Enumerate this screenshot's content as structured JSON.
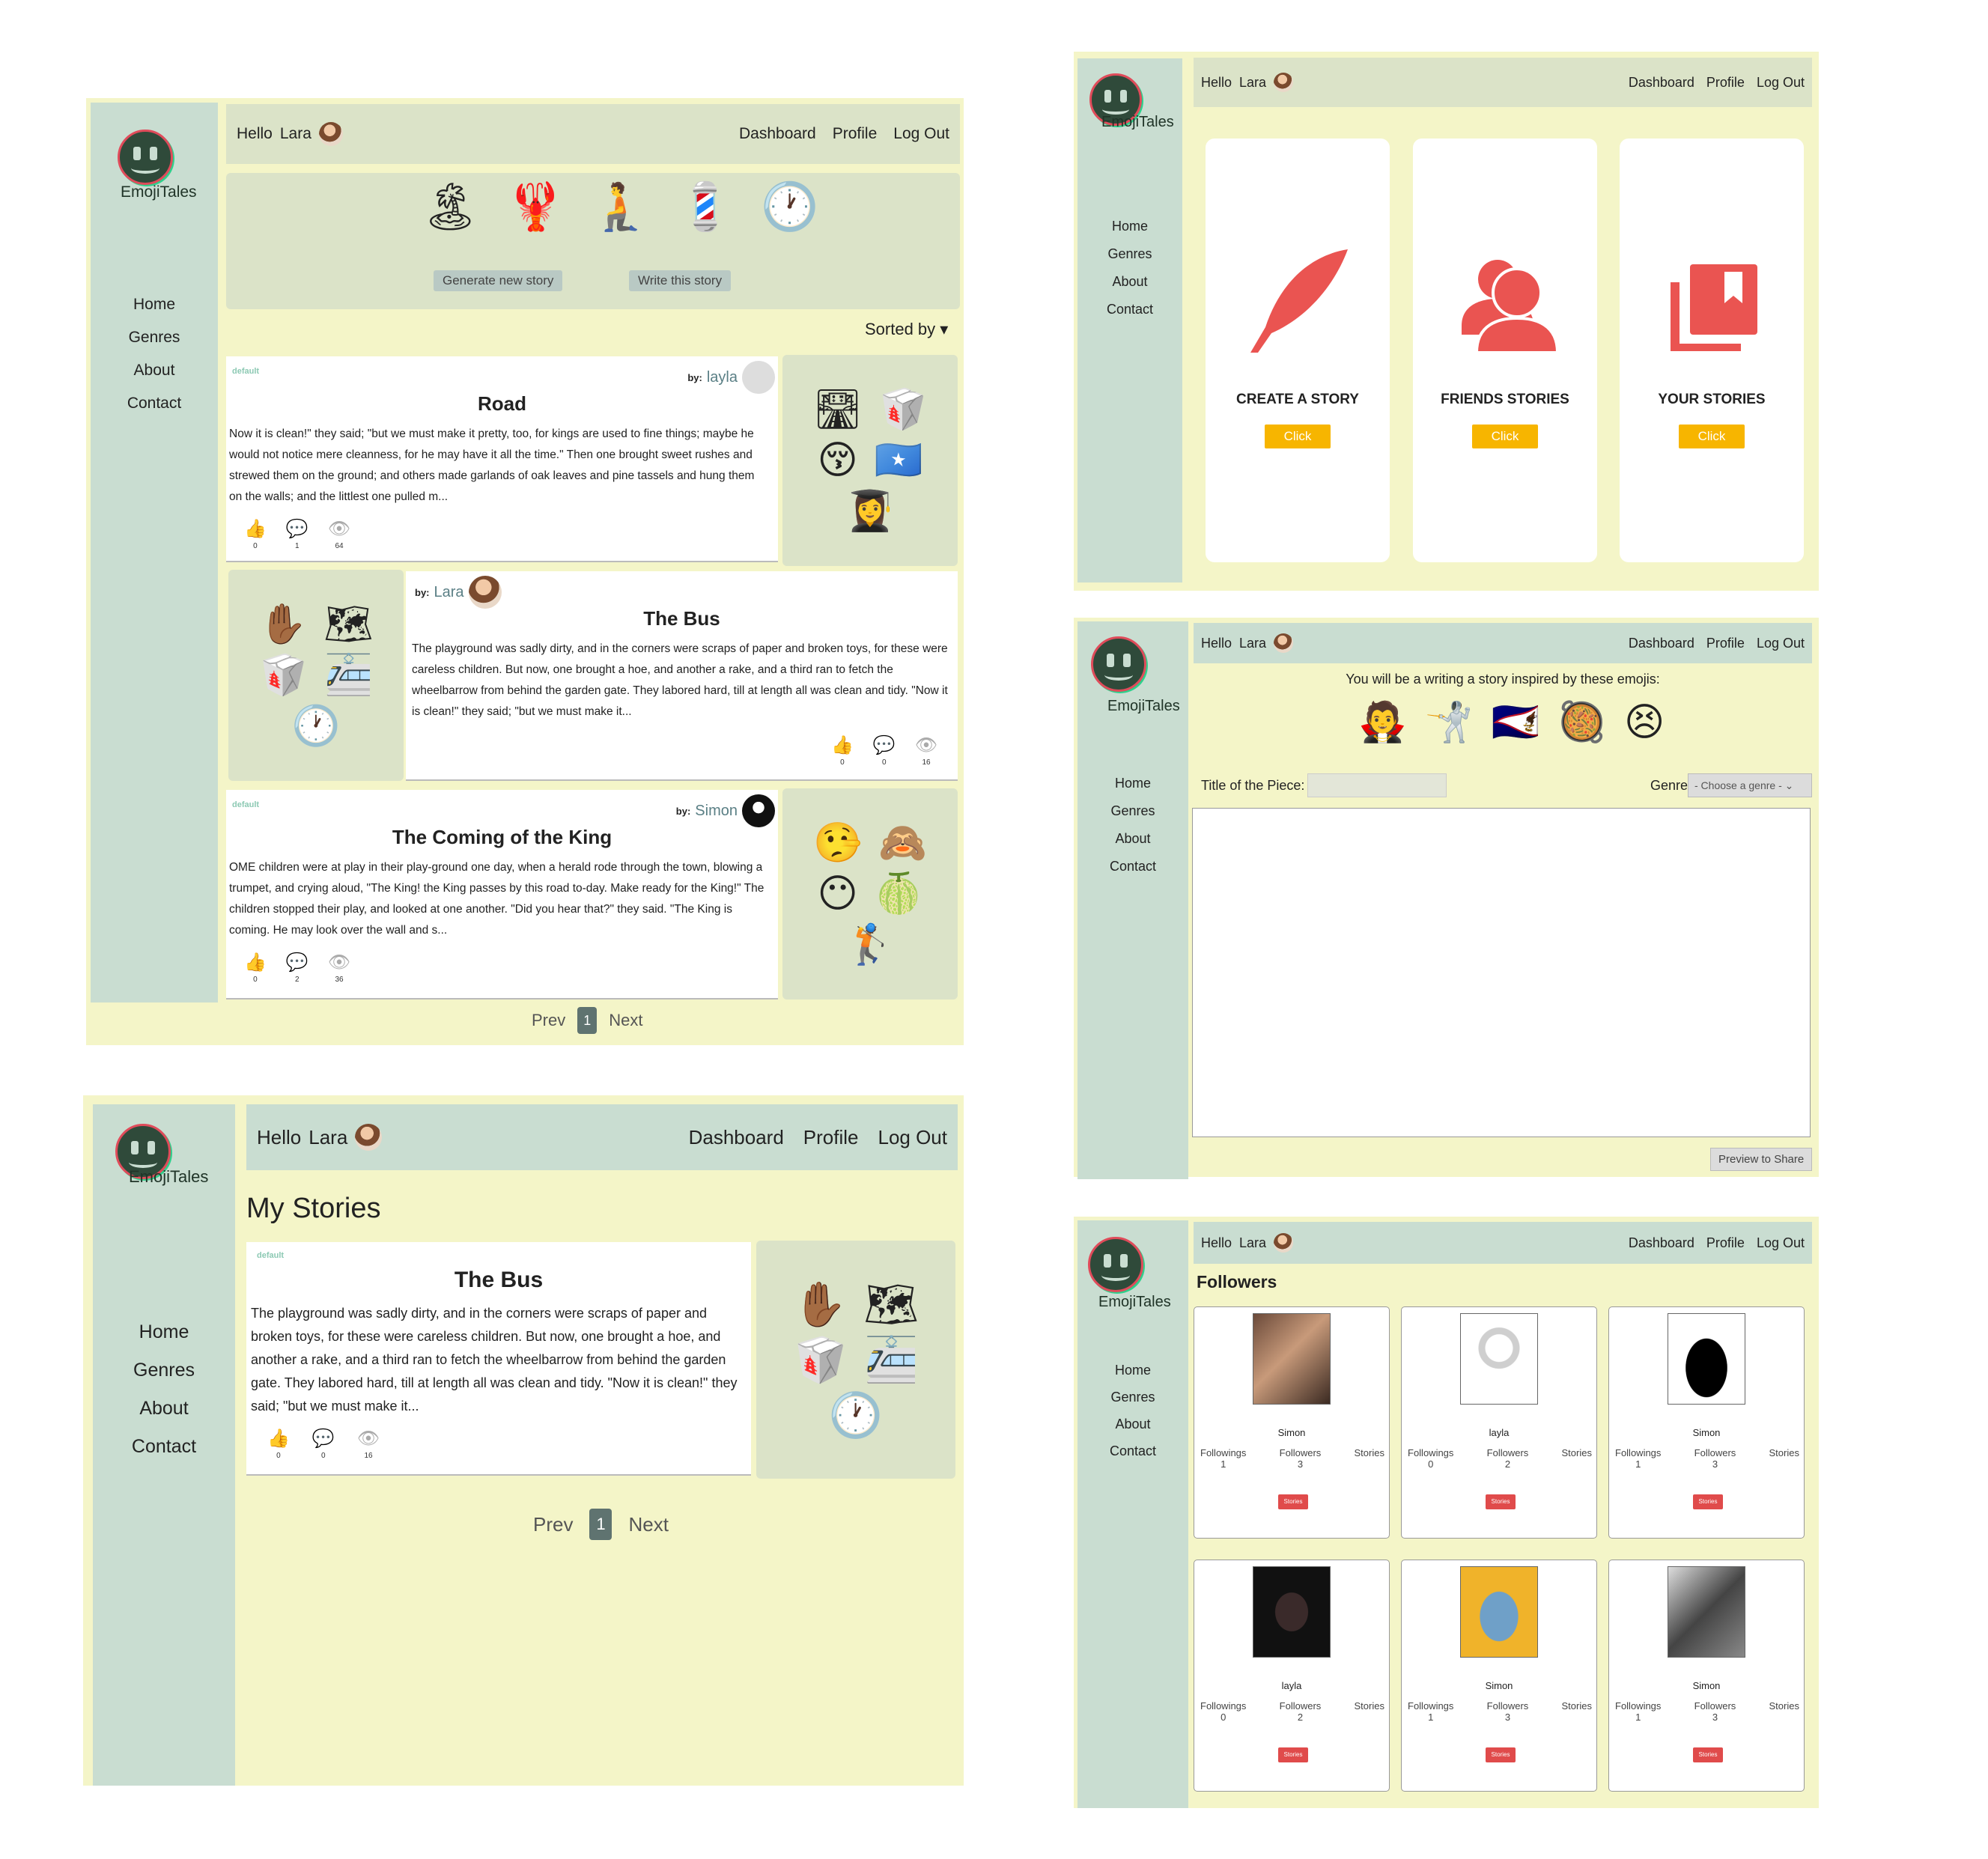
{
  "brand": "EmojiTales",
  "user": "Lara",
  "hello": "Hello",
  "nav": {
    "home": "Home",
    "genres": "Genres",
    "about": "About",
    "contact": "Contact"
  },
  "top": {
    "dashboard": "Dashboard",
    "profile": "Profile",
    "logout": "Log Out"
  },
  "gen": {
    "emojis": [
      "🏝",
      "🦞",
      "🧎",
      "💈",
      "🕐"
    ],
    "generate": "Generate new story",
    "write": "Write this story",
    "sorted": "Sorted by"
  },
  "stories": [
    {
      "tag": "default",
      "by": "by:",
      "author": "layla",
      "title": "Road",
      "text": "Now it is clean!\" they said; \"but we must make it pretty, too, for kings are used to fine things; maybe he would not notice mere cleanness, for he may have it all the time.\" Then one brought sweet rushes and strewed them on the ground; and others made garlands of oak leaves and pine tassels and hung them on the walls; and the littlest one pulled m...",
      "likes": "0",
      "comments": "1",
      "views": "64",
      "emojis": [
        "🛣",
        "🥡",
        "😚",
        "🇸🇴",
        "👩‍🎓"
      ]
    },
    {
      "by": "by:",
      "author": "Lara",
      "title": "The Bus",
      "text": "The playground was sadly dirty, and in the corners were scraps of paper and broken toys, for these were careless children. But now, one brought a hoe, and another a rake, and a third ran to fetch the wheelbarrow from behind the garden gate. They labored hard, till at length all was clean and tidy. \"Now it is clean!\" they said; \"but we must make it...",
      "likes": "0",
      "comments": "0",
      "views": "16",
      "emojis": [
        "✋🏾",
        "🗺",
        "🥡",
        "🚈",
        "🕐"
      ]
    },
    {
      "tag": "default",
      "by": "by:",
      "author": "Simon",
      "title": "The Coming of the King",
      "text": "OME children were at play in their play-ground one day, when a herald rode through the town, blowing a trumpet, and crying aloud, \"The King! the King passes by this road to-day. Make ready for the King!\" The children stopped their play, and looked at one another. \"Did you hear that?\" they said. \"The King is coming. He may look over the wall and s...",
      "likes": "0",
      "comments": "2",
      "views": "36",
      "emojis": [
        "🤥",
        "🙈",
        "😶",
        "🍈",
        "🏌"
      ]
    }
  ],
  "pager": {
    "prev": "Prev",
    "page": "1",
    "next": "Next"
  },
  "dash": {
    "create": "CREATE A STORY",
    "friends": "FRIENDS STORIES",
    "yours": "YOUR STORIES",
    "click": "Click"
  },
  "write": {
    "intro": "You will be a writing a story inspired by these emojis:",
    "emojis": [
      "🧛",
      "🤺",
      "🇦🇸",
      "🥘",
      "😣"
    ],
    "title_label": "Title of the Piece:",
    "genre_label": "Genre:",
    "genre_value": "- Choose a genre -",
    "preview": "Preview to Share"
  },
  "mystories": {
    "heading": "My Stories",
    "tag": "default",
    "title": "The Bus",
    "text": "The playground was sadly dirty, and in the corners were scraps of paper and broken toys, for these were careless children. But now, one brought a hoe, and another a rake, and a third ran to fetch the wheelbarrow from behind the garden gate. They labored hard, till at length all was clean and tidy. \"Now it is clean!\" they said; \"but we must make it...",
    "likes": "0",
    "comments": "0",
    "views": "16",
    "emojis": [
      "✋🏾",
      "🗺",
      "🥡",
      "🚈",
      "🕐"
    ]
  },
  "followers": {
    "heading": "Followers",
    "labels": {
      "followings": "Followings",
      "followers": "Followers",
      "stories": "Stories",
      "btn": "Stories"
    },
    "items": [
      {
        "name": "Simon",
        "followings": "1",
        "followers": "3"
      },
      {
        "name": "layla",
        "followings": "0",
        "followers": "2"
      },
      {
        "name": "Simon",
        "followings": "1",
        "followers": "3"
      },
      {
        "name": "layla",
        "followings": "0",
        "followers": "2"
      },
      {
        "name": "Simon",
        "followings": "1",
        "followers": "3"
      },
      {
        "name": "Simon",
        "followings": "1",
        "followers": "3"
      }
    ]
  }
}
